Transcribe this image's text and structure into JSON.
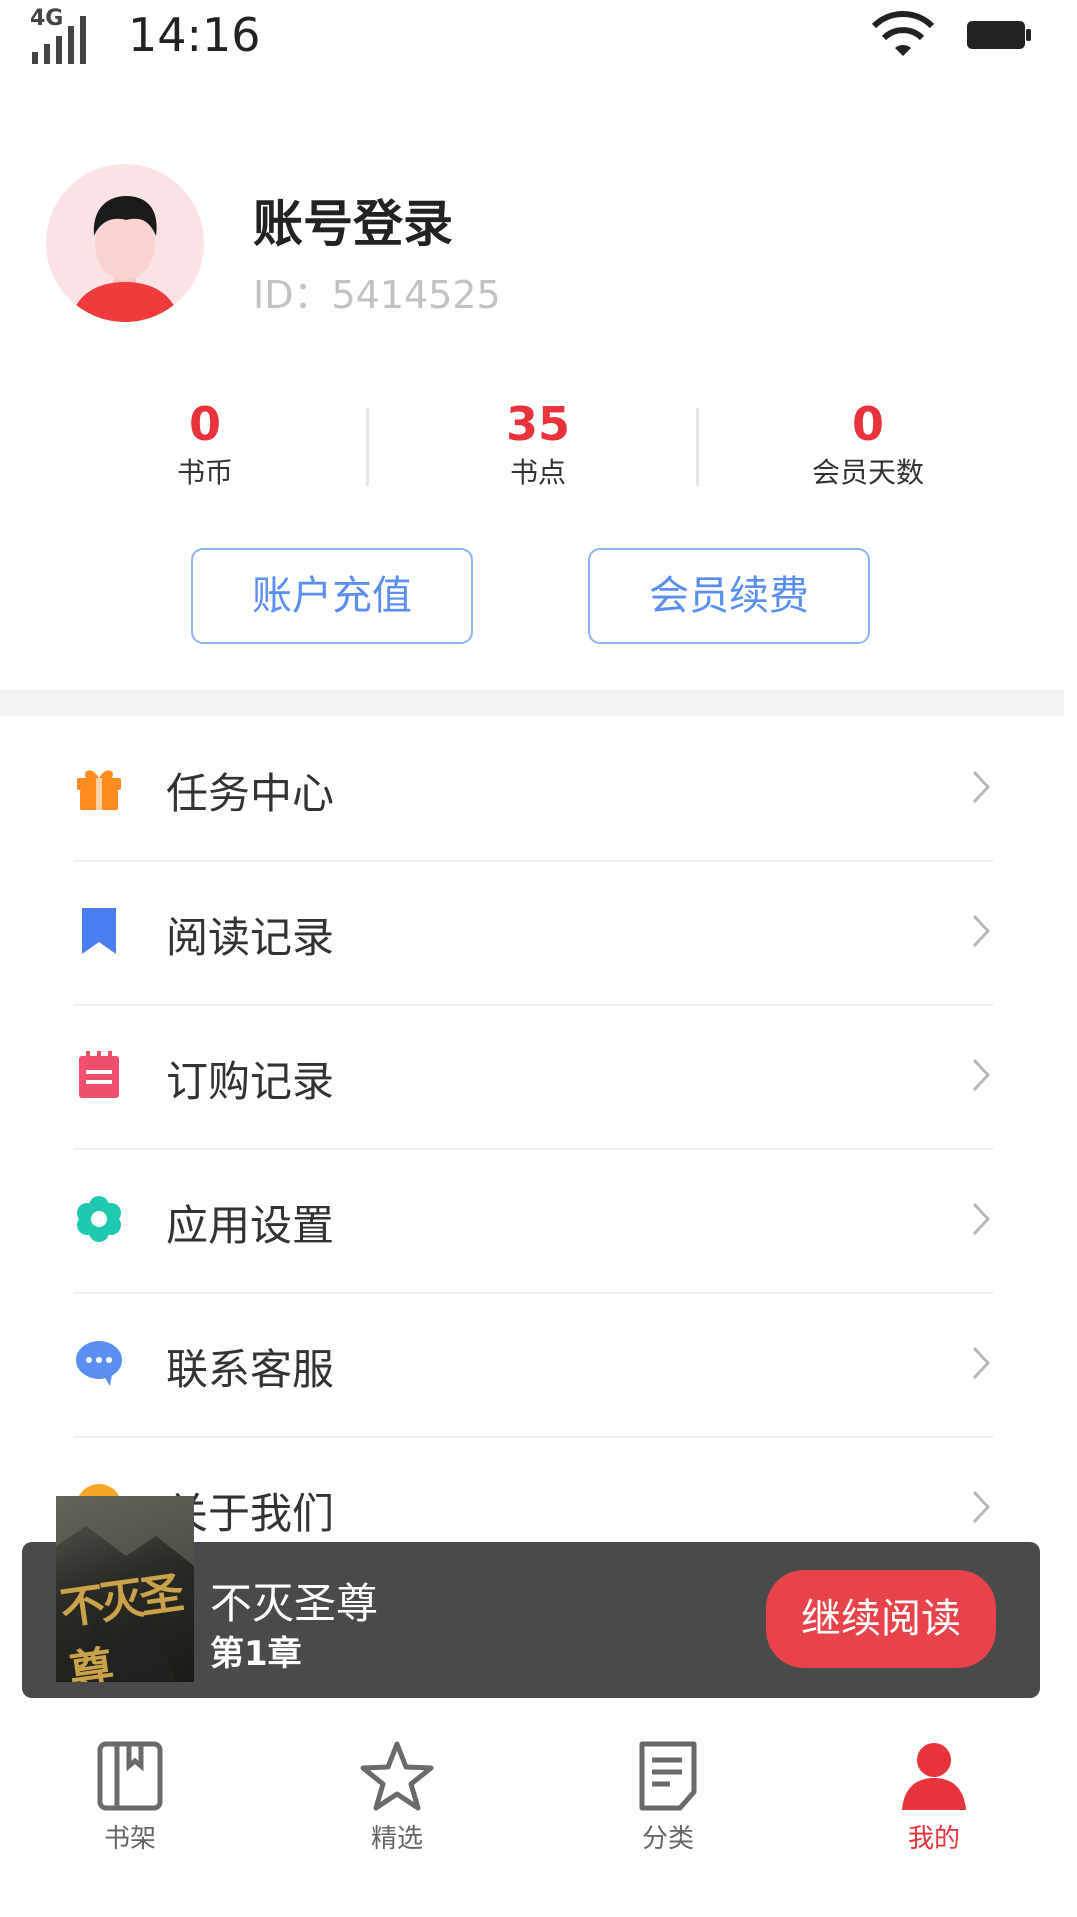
{
  "status_bar": {
    "network": "4G",
    "time": "14:16",
    "icons": [
      "signal-icon",
      "wifi-icon",
      "battery-icon"
    ]
  },
  "profile": {
    "name": "账号登录",
    "id_text": "ID：5414525"
  },
  "stats": [
    {
      "value": "0",
      "label": "书币"
    },
    {
      "value": "35",
      "label": "书点"
    },
    {
      "value": "0",
      "label": "会员天数"
    }
  ],
  "actions": {
    "recharge": "账户充值",
    "renew": "会员续费"
  },
  "menu": [
    {
      "label": "任务中心",
      "icon": "gift-icon",
      "color": "#ff8a1f"
    },
    {
      "label": "阅读记录",
      "icon": "bookmark-icon",
      "color": "#4a7cf2"
    },
    {
      "label": "订购记录",
      "icon": "notepad-icon",
      "color": "#f0506e"
    },
    {
      "label": "应用设置",
      "icon": "gear-icon",
      "color": "#1fc9b0"
    },
    {
      "label": "联系客服",
      "icon": "chat-icon",
      "color": "#5a8ef0"
    },
    {
      "label": "关于我们",
      "icon": "info-icon",
      "color": "#f5a623"
    }
  ],
  "now_reading": {
    "cover_text": "不灭圣尊",
    "title": "不灭圣尊",
    "chapter": "第1章",
    "button": "继续阅读"
  },
  "tabs": [
    {
      "label": "书架",
      "icon": "bookshelf-icon"
    },
    {
      "label": "精选",
      "icon": "star-icon"
    },
    {
      "label": "分类",
      "icon": "document-icon"
    },
    {
      "label": "我的",
      "icon": "person-icon",
      "active": true
    }
  ],
  "colors": {
    "accent": "#e8323c",
    "button_blue": "#5a8ef0",
    "player_bg": "#4a4a4a"
  }
}
